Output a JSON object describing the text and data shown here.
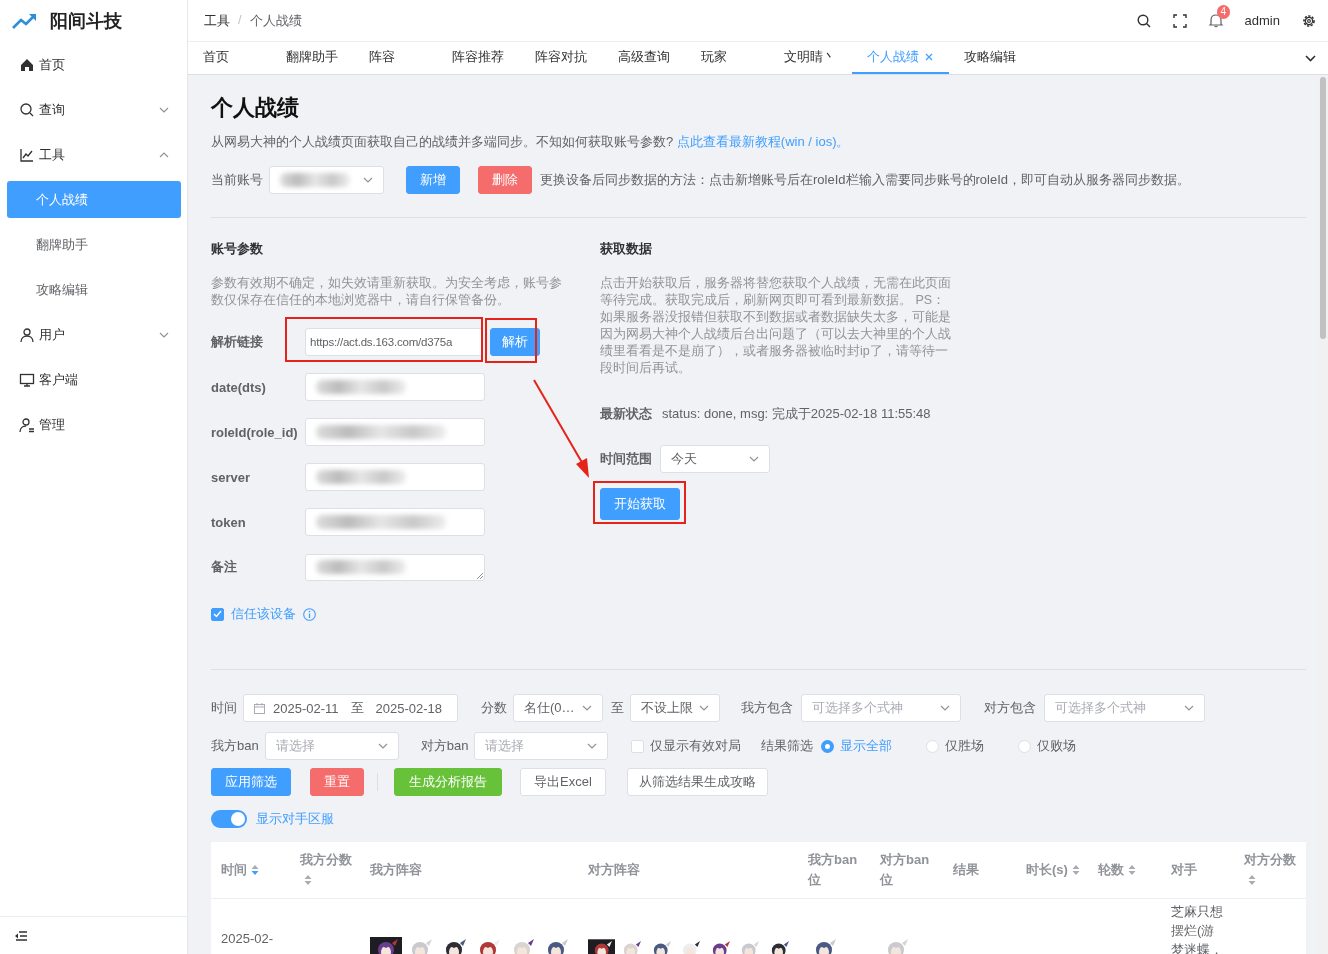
{
  "sidebar": {
    "brand": "阳间斗技",
    "items": [
      {
        "label": "首页",
        "kind": "link",
        "selected": false
      },
      {
        "label": "查询",
        "kind": "group",
        "expanded": false,
        "selected": false
      },
      {
        "label": "工具",
        "kind": "group",
        "expanded": true,
        "selected": false,
        "children": [
          {
            "label": "个人战绩",
            "selected": true
          },
          {
            "label": "翻牌助手",
            "selected": false
          },
          {
            "label": "攻略编辑",
            "selected": false
          }
        ]
      },
      {
        "label": "用户",
        "kind": "group",
        "expanded": false,
        "selected": false
      },
      {
        "label": "客户端",
        "kind": "link",
        "selected": false
      },
      {
        "label": "管理",
        "kind": "link",
        "selected": false
      }
    ]
  },
  "header": {
    "breadcrumb": [
      "工具",
      "个人战绩"
    ],
    "breadcrumb_separator": "/",
    "notifications": "4",
    "user": "admin"
  },
  "tabs": [
    {
      "label": "首页",
      "selected": false
    },
    {
      "label": "翻牌助手",
      "selected": false
    },
    {
      "label": "阵容",
      "selected": false
    },
    {
      "label": "阵容推荐",
      "selected": false
    },
    {
      "label": "阵容对抗",
      "selected": false
    },
    {
      "label": "高级查询",
      "selected": false
    },
    {
      "label": "玩家",
      "selected": false
    },
    {
      "label": "文明睛丶",
      "selected": false
    },
    {
      "label": "个人战绩",
      "selected": true
    },
    {
      "label": "攻略编辑",
      "selected": false
    }
  ],
  "page": {
    "title": "个人战绩",
    "intro": "从网易大神的个人战绩页面获取自己的战绩并多端同步。不知如何获取账号参数?",
    "intro_link": "点此查看最新教程(win / ios)。",
    "account": {
      "label": "当前账号",
      "blurred": true,
      "buttons": [
        {
          "label": "新增",
          "kind": "primary"
        },
        {
          "label": "删除",
          "kind": "danger"
        }
      ],
      "hint": "更换设备后同步数据的方法：点击新增账号后在roleId栏输入需要同步账号的roleId，即可自动从服务器同步数据。"
    }
  },
  "params": {
    "title": "账号参数",
    "description": "参数有效期不确定，如失效请重新获取。为安全考虑，账号参数仅保存在信任的本地浏览器中，请自行保管备份。",
    "parse_button": "解析",
    "fields": [
      {
        "label": "解析链接",
        "kind": "input",
        "value": "https://act.ds.163.com/d375a"
      },
      {
        "label": "date(dts)",
        "kind": "input",
        "blurred": true
      },
      {
        "label": "roleId(role_id)",
        "kind": "input",
        "blurred": true
      },
      {
        "label": "server",
        "kind": "input",
        "blurred": true
      },
      {
        "label": "token",
        "kind": "input",
        "blurred": true
      },
      {
        "label": "备注",
        "kind": "textarea",
        "blurred": true
      }
    ],
    "trust": {
      "label": "信任该设备",
      "checked": true
    }
  },
  "fetch": {
    "title": "获取数据",
    "description": "点击开始获取后，服务器将替您获取个人战绩，无需在此页面等待完成。获取完成后，刷新网页即可看到最新数据。 PS：如果服务器没报错但获取不到数据或者数据缺失太多，可能是因为网易大神个人战绩后台出问题了（可以去大神里的个人战绩里看看是不是崩了），或者服务器被临时封ip了，请等待一段时间后再试。",
    "status_label": "最新状态",
    "status": "status: done, msg: 完成于2025-02-18 11:55:48",
    "range_label": "时间范围",
    "range": "今天",
    "button": "开始获取"
  },
  "filters": {
    "time": {
      "label": "时间",
      "start": "2025-02-11",
      "separator": "至",
      "end": "2025-02-18"
    },
    "score": {
      "label": "分数",
      "from": "名仕(0…",
      "separator": "至",
      "to": "不设上限"
    },
    "my_include": {
      "label": "我方包含",
      "placeholder": "可选择多个式神"
    },
    "opp_include": {
      "label": "对方包含",
      "placeholder": "可选择多个式神"
    },
    "my_ban": {
      "label": "我方ban",
      "placeholder": "请选择"
    },
    "opp_ban": {
      "label": "对方ban",
      "placeholder": "请选择"
    },
    "valid_only": {
      "label": "仅显示有效对局",
      "checked": false
    },
    "result": {
      "label": "结果筛选",
      "options": [
        {
          "label": "显示全部",
          "selected": true
        },
        {
          "label": "仅胜场",
          "selected": false
        },
        {
          "label": "仅败场",
          "selected": false
        }
      ]
    },
    "buttons": [
      {
        "label": "应用筛选",
        "kind": "primary"
      },
      {
        "label": "重置",
        "kind": "danger"
      },
      {
        "label": "生成分析报告",
        "kind": "success"
      },
      {
        "label": "导出Excel",
        "kind": "default"
      },
      {
        "label": "从筛选结果生成攻略",
        "kind": "default"
      }
    ],
    "show_server": {
      "label": "显示对手区服",
      "on": true
    }
  },
  "table": {
    "columns": [
      {
        "label": "时间",
        "sortable": true,
        "sorted": true
      },
      {
        "label": "我方分数",
        "sortable": true,
        "sorted": false
      },
      {
        "label": "我方阵容"
      },
      {
        "label": "对方阵容"
      },
      {
        "label": "我方ban位"
      },
      {
        "label": "对方ban位"
      },
      {
        "label": "结果"
      },
      {
        "label": "时长(s)",
        "sortable": true,
        "sorted": false
      },
      {
        "label": "轮数",
        "sortable": true,
        "sorted": false
      },
      {
        "label": "对手"
      },
      {
        "label": "对方分数",
        "sortable": true,
        "sorted": false
      }
    ],
    "rows": [
      {
        "time": "2025-02-",
        "opponent": "芝麻只想摆烂(游梦迷蝶，"
      }
    ]
  }
}
